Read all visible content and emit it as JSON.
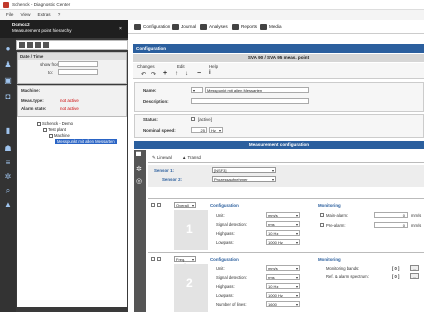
{
  "window": {
    "title": "Schenck - Diagnostic Center"
  },
  "menu": {
    "items": [
      "File",
      "View",
      "Extras",
      "?"
    ]
  },
  "left_panel": {
    "title": "Dcmcc2",
    "subtitle": "Measurement point hierarchy",
    "date_time_label": "Date / Time",
    "from_label": "show from:",
    "to_label": "to:",
    "machine_label": "Machine:",
    "meas_type_label": "Meas.type:",
    "meas_type_value": "not active",
    "alarm_state_label": "Alarm state:",
    "alarm_state_value": "not active",
    "tree": [
      {
        "label": "Schenck - Demo",
        "level": 0,
        "selected": false
      },
      {
        "label": "Test plant",
        "level": 1,
        "selected": false
      },
      {
        "label": "Machine",
        "level": 2,
        "selected": false
      },
      {
        "label": "Messpunkt mit allen Messarten",
        "level": 3,
        "selected": true
      }
    ]
  },
  "tabs": [
    {
      "label": "Configuration",
      "icon": "gear-icon"
    },
    {
      "label": "Journal",
      "icon": "journal-icon"
    },
    {
      "label": "Analyses",
      "icon": "chart-icon"
    },
    {
      "label": "Reports",
      "icon": "report-icon"
    },
    {
      "label": "Media",
      "icon": "camera-icon"
    }
  ],
  "config": {
    "header": "Configuration",
    "point_title": "SVA 90 / SVA 95 meas. point",
    "toolbar": {
      "changes_label": "Changes",
      "edit_label": "Edit",
      "help_label": "Help"
    },
    "name_label": "Name:",
    "name_value": "Messpunkt mit allen Messarten",
    "description_label": "Description:",
    "status_label": "Status:",
    "status_value": "[active]",
    "nominal_speed_label": "Nominal speed:",
    "nominal_speed_value": "25",
    "nominal_speed_unit": "Hz"
  },
  "meas_config": {
    "header": "Measurement configuration",
    "subtabs": [
      "Linewal",
      "Transd"
    ],
    "sensor1_label": "Sensor 1:",
    "sensor1_value": "[NSF3]",
    "sensor2_label": "Sensor 2:",
    "sensor2_value": "Prozessaufnehmer",
    "blocks": [
      {
        "number": "1",
        "type": "Overall",
        "config_title": "Configuration",
        "rows": [
          {
            "label": "Unit:",
            "value": "mm/s"
          },
          {
            "label": "Signal detection:",
            "value": "rms"
          },
          {
            "label": "Highpass:",
            "value": "10 Hz"
          },
          {
            "label": "Lowpass:",
            "value": "1000 Hz"
          }
        ],
        "monitoring_title": "Monitoring",
        "monitoring": [
          {
            "label": "Main-alarm:",
            "value": "0",
            "unit": "mm/s"
          },
          {
            "label": "Pre-alarm:",
            "value": "0",
            "unit": "mm/s"
          }
        ]
      },
      {
        "number": "2",
        "type": "Freq. spectrum",
        "config_title": "Configuration",
        "rows": [
          {
            "label": "Unit:",
            "value": "mm/s"
          },
          {
            "label": "Signal detection:",
            "value": "rms"
          },
          {
            "label": "Highpass:",
            "value": "10 Hz"
          },
          {
            "label": "Lowpass:",
            "value": "1000 Hz"
          },
          {
            "label": "Number of lines:",
            "value": "1600"
          }
        ],
        "monitoring_title": "Monitoring",
        "monitoring": [
          {
            "label": "Monitoring bands:",
            "value": "[ 0 ]",
            "unit": "..."
          },
          {
            "label": "Ref. & alarm spectrum:",
            "value": "[ 0 ]",
            "unit": "..."
          }
        ]
      }
    ]
  },
  "colors": {
    "accent": "#2b5f9e",
    "sidebar": "#2f2f2f",
    "alert": "#cc0000",
    "selection": "#2a64c5"
  }
}
